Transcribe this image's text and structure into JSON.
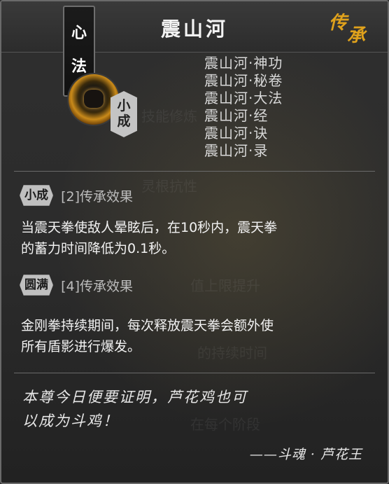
{
  "header": {
    "title": "震山河",
    "heritage_char_1": "传",
    "heritage_char_2": "承"
  },
  "category": {
    "char_1": "心",
    "char_2": "法"
  },
  "skill": {
    "icon": "fist-lightning-icon",
    "rank": "小成"
  },
  "aliases": [
    "震山河·神功",
    "震山河·秘卷",
    "震山河·大法",
    "震山河·经",
    "震山河·诀",
    "震山河·录"
  ],
  "effects": [
    {
      "badge": "小成",
      "title": "[2]传承效果",
      "lines": [
        "当震天拳使敌人晕眩后，在10秒内，震天拳",
        "的蓄力时间降低为0.1秒。"
      ]
    },
    {
      "badge": "圆满",
      "title": "[4]传承效果",
      "lines": [
        "金刚拳持续期间，每次释放震天拳会额外使",
        "所有盾影进行爆发。"
      ]
    }
  ],
  "quote": {
    "line_1": "本尊今日便要证明，芦花鸡也可",
    "line_2": "以成为斗鸡！",
    "author": "——斗魂 · 芦花王"
  },
  "colors": {
    "heritage_accent": "#e0a21c",
    "badge_bg": "#bfbfbf"
  }
}
